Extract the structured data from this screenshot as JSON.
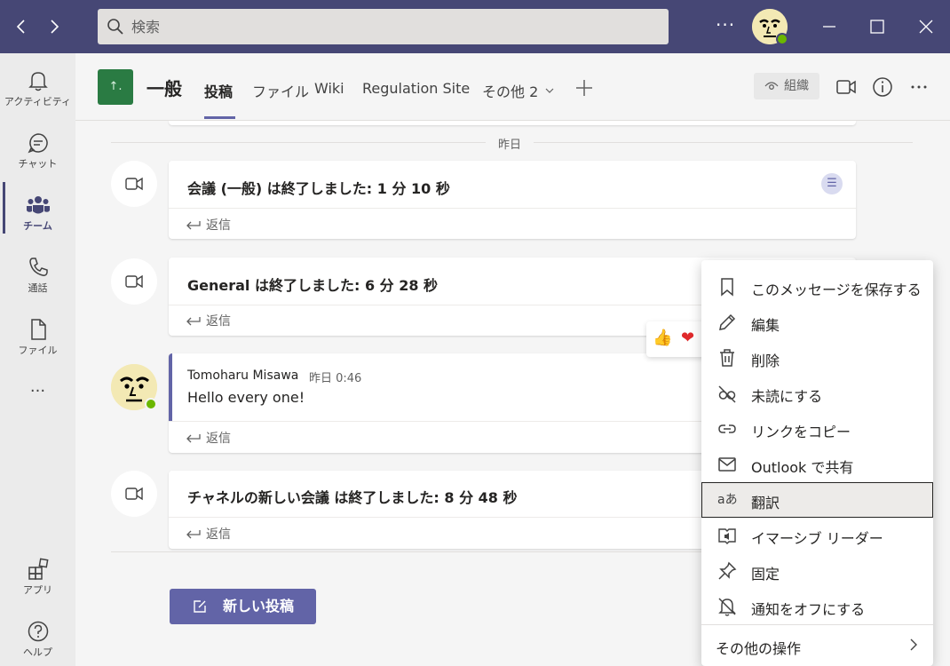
{
  "titlebar": {
    "back_icon": "chevron-left-icon",
    "forward_icon": "chevron-right-icon",
    "search_placeholder": "検索",
    "more_label": "···",
    "status_color": "#6bb700"
  },
  "rail": {
    "items": [
      {
        "label": "アクティビティ",
        "icon": "bell-icon"
      },
      {
        "label": "チャット",
        "icon": "chat-icon"
      },
      {
        "label": "チーム",
        "icon": "teams-icon",
        "active": true
      },
      {
        "label": "通話",
        "icon": "phone-icon"
      },
      {
        "label": "ファイル",
        "icon": "file-icon"
      }
    ],
    "more_label": "···",
    "apps_label": "アプリ",
    "help_label": "ヘルプ"
  },
  "header": {
    "team_tile": "↑.",
    "channel_name": "一般",
    "tabs": [
      "投稿",
      "ファイル",
      "Wiki",
      "Regulation Site",
      "その他 2"
    ],
    "org_label": "組織",
    "accent_color": "#6264a7"
  },
  "feed": {
    "date_label": "昨日",
    "messages": [
      {
        "title": "会議 (一般) は終了しました: 1 分 10 秒",
        "reply": "返信"
      },
      {
        "title": "General は終了しました: 6 分 28 秒",
        "reply": "返信"
      },
      {
        "author": "Tomoharu Misawa",
        "time": "昨日 0:46",
        "body": "Hello every one!",
        "reply": "返信"
      },
      {
        "title": "チャネルの新しい会議 は終了しました: 8 分 48 秒",
        "reply": "返信"
      }
    ],
    "new_post_label": "新しい投稿"
  },
  "menu": {
    "items": [
      {
        "label": "このメッセージを保存する",
        "icon": "bookmark-icon"
      },
      {
        "label": "編集",
        "icon": "pencil-icon"
      },
      {
        "label": "削除",
        "icon": "trash-icon"
      },
      {
        "label": "未読にする",
        "icon": "unread-icon"
      },
      {
        "label": "リンクをコピー",
        "icon": "link-icon"
      },
      {
        "label": "Outlook で共有",
        "icon": "mail-icon"
      },
      {
        "label": "翻訳",
        "icon": "translate-icon",
        "highlighted": true
      },
      {
        "label": "イマーシブ リーダー",
        "icon": "immersive-reader-icon"
      },
      {
        "label": "固定",
        "icon": "pin-icon"
      },
      {
        "label": "通知をオフにする",
        "icon": "bell-off-icon"
      }
    ],
    "more_actions": "その他の操作"
  }
}
